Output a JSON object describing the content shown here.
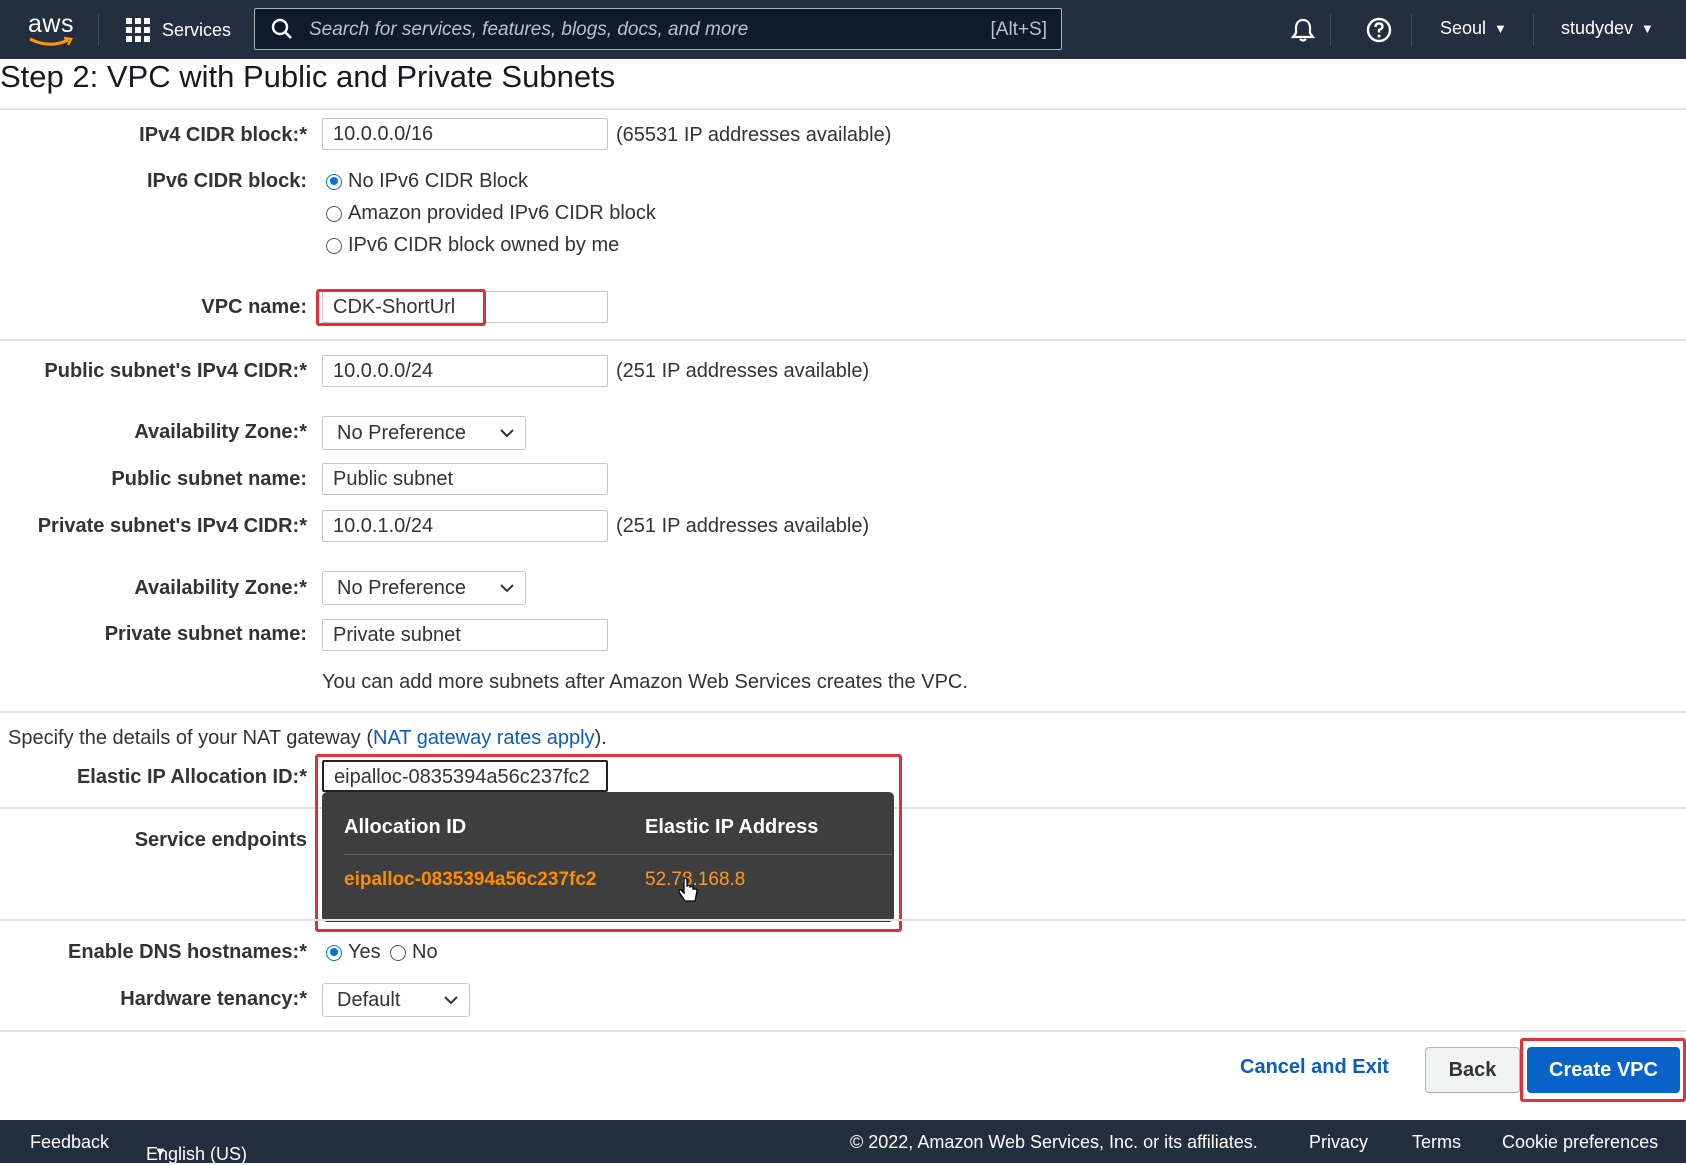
{
  "nav": {
    "logo_text": "aws",
    "services_label": "Services",
    "search_placeholder": "Search for services, features, blogs, docs, and more",
    "search_shortcut": "[Alt+S]",
    "region": "Seoul",
    "user": "studydev"
  },
  "page": {
    "title": "Step 2: VPC with Public and Private Subnets"
  },
  "form": {
    "ipv4_label": "IPv4 CIDR block:*",
    "ipv4_value": "10.0.0.0/16",
    "ipv4_hint": "(65531 IP addresses available)",
    "ipv6_label": "IPv6 CIDR block:",
    "ipv6_options": [
      "No IPv6 CIDR Block",
      "Amazon provided IPv6 CIDR block",
      "IPv6 CIDR block owned by me"
    ],
    "ipv6_selected": "No IPv6 CIDR Block",
    "vpc_name_label": "VPC name:",
    "vpc_name_value": "CDK-ShortUrl",
    "public_cidr_label": "Public subnet's IPv4 CIDR:*",
    "public_cidr_value": "10.0.0.0/24",
    "public_cidr_hint": "(251 IP addresses available)",
    "az_label": "Availability Zone:*",
    "az_public_value": "No Preference",
    "public_name_label": "Public subnet name:",
    "public_name_value": "Public subnet",
    "private_cidr_label": "Private subnet's IPv4 CIDR:*",
    "private_cidr_value": "10.0.1.0/24",
    "private_cidr_hint": "(251 IP addresses available)",
    "az_private_value": "No Preference",
    "private_name_label": "Private subnet name:",
    "private_name_value": "Private subnet",
    "subnets_note": "You can add more subnets after Amazon Web Services creates the VPC.",
    "nat_intro_pre": "Specify the details of your NAT gateway (",
    "nat_link": "NAT gateway rates apply",
    "nat_intro_post": ").",
    "eip_label": "Elastic IP Allocation ID:*",
    "eip_value": "eipalloc-0835394a56c237fc2",
    "service_endpoints_label": "Service endpoints",
    "dns_label": "Enable DNS hostnames:*",
    "dns_yes": "Yes",
    "dns_no": "No",
    "dns_selected": "Yes",
    "tenancy_label": "Hardware tenancy:*",
    "tenancy_value": "Default"
  },
  "dropdown": {
    "col1_header": "Allocation ID",
    "col2_header": "Elastic IP Address",
    "rows": [
      {
        "allocation_id": "eipalloc-0835394a56c237fc2",
        "address": "52.78.168.8"
      }
    ]
  },
  "actions": {
    "cancel": "Cancel and Exit",
    "back": "Back",
    "create": "Create VPC"
  },
  "footer": {
    "feedback": "Feedback",
    "language": "English (US)",
    "copyright": "© 2022, Amazon Web Services, Inc. or its affiliates.",
    "privacy": "Privacy",
    "terms": "Terms",
    "cookie": "Cookie preferences"
  },
  "colors": {
    "nav_bg": "#232f3e",
    "primary": "#0a63c9",
    "highlight": "#e0303a",
    "dropdown_accent": "#ff8c00"
  }
}
